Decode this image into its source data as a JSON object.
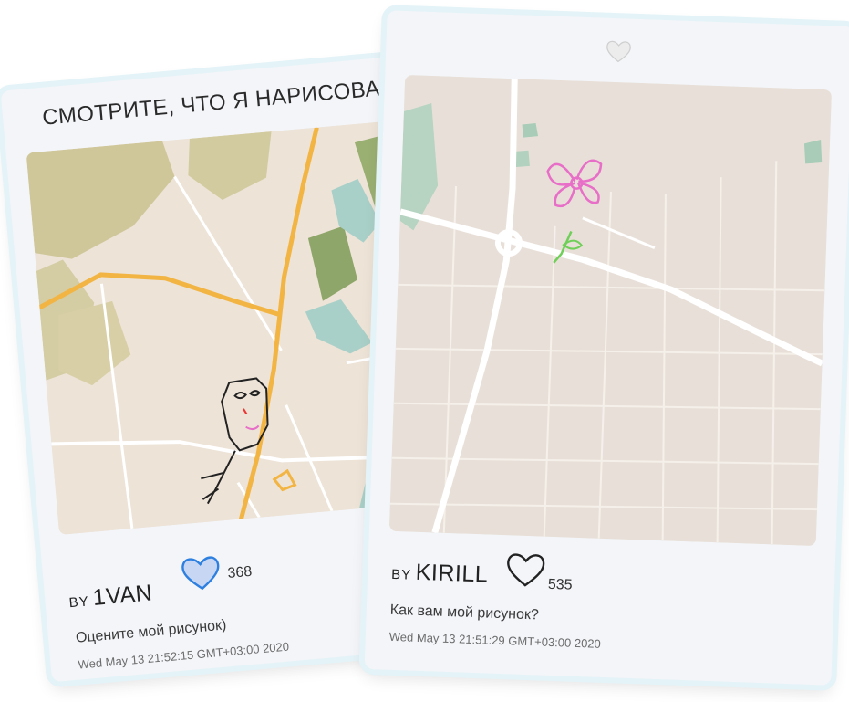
{
  "posts": [
    {
      "headline": "СМОТРИТЕ, ЧТО Я НАРИСОВАЛ!",
      "by_label": "BY",
      "author": "1VAN",
      "likes": "368",
      "liked": true,
      "caption": "Оцените мой рисунок)",
      "timestamp": "Wed May 13 21:52:15 GMT+03:00 2020",
      "drawing": "face-doodle"
    },
    {
      "by_label": "BY",
      "author": "KIRILL",
      "likes": "535",
      "liked": false,
      "caption": "Как вам мой рисунок?",
      "timestamp": "Wed May 13 21:51:29 GMT+03:00 2020",
      "drawing": "flower-doodle"
    }
  ],
  "icons": {
    "like": "heart-icon",
    "top": "heart-icon"
  },
  "colors": {
    "heart_liked_fill": "#c7d6f2",
    "heart_liked_stroke": "#2d7fe0",
    "road_major": "#f2b443",
    "water": "#a9d0c8",
    "park": "#cfc79a",
    "flower": "#e86fc8",
    "stem": "#6fcf58"
  }
}
